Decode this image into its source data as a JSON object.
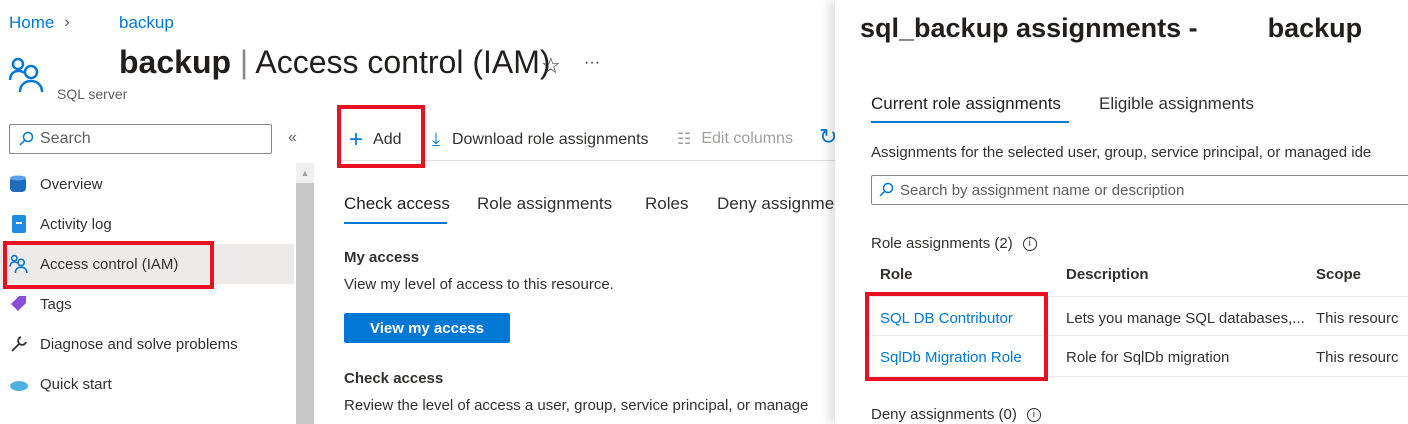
{
  "breadcrumb": {
    "home": "Home",
    "current": "backup"
  },
  "header": {
    "resource": "backup",
    "title": "Access control (IAM)",
    "subtitle": "SQL server",
    "star": "☆",
    "more": "···"
  },
  "sidebar": {
    "search_placeholder": "Search",
    "collapse": "«",
    "items": [
      {
        "label": "Overview",
        "icon": "sql-database-icon"
      },
      {
        "label": "Activity log",
        "icon": "activity-log-icon"
      },
      {
        "label": "Access control (IAM)",
        "icon": "people-icon",
        "selected": true
      },
      {
        "label": "Tags",
        "icon": "tag-icon"
      },
      {
        "label": "Diagnose and solve problems",
        "icon": "wrench-icon"
      },
      {
        "label": "Quick start",
        "icon": "cloud-icon"
      }
    ]
  },
  "toolbar": {
    "add": "Add",
    "download": "Download role assignments",
    "edit_columns": "Edit columns"
  },
  "tabs": [
    "Check access",
    "Role assignments",
    "Roles",
    "Deny assignme"
  ],
  "main": {
    "my_access_title": "My access",
    "my_access_desc": "View my level of access to this resource.",
    "view_button": "View my access",
    "check_title": "Check access",
    "check_desc": "Review the level of access a user, group, service principal, or manage"
  },
  "panel": {
    "title_left": "sql_backup assignments -",
    "title_right": "backup",
    "tabs": [
      "Current role assignments",
      "Eligible assignments"
    ],
    "intro": "Assignments for the selected user, group, service principal, or managed ide",
    "search_placeholder": "Search by assignment name or description",
    "role_assignments_label": "Role assignments (2)",
    "columns": [
      "Role",
      "Description",
      "Scope"
    ],
    "rows": [
      {
        "role": "SQL DB Contributor",
        "description": "Lets you manage SQL databases,...",
        "scope": "This resourc"
      },
      {
        "role": "SqlDb Migration Role",
        "description": "Role for SqlDb migration",
        "scope": "This resourc"
      }
    ],
    "deny_label": "Deny assignments (0)"
  }
}
